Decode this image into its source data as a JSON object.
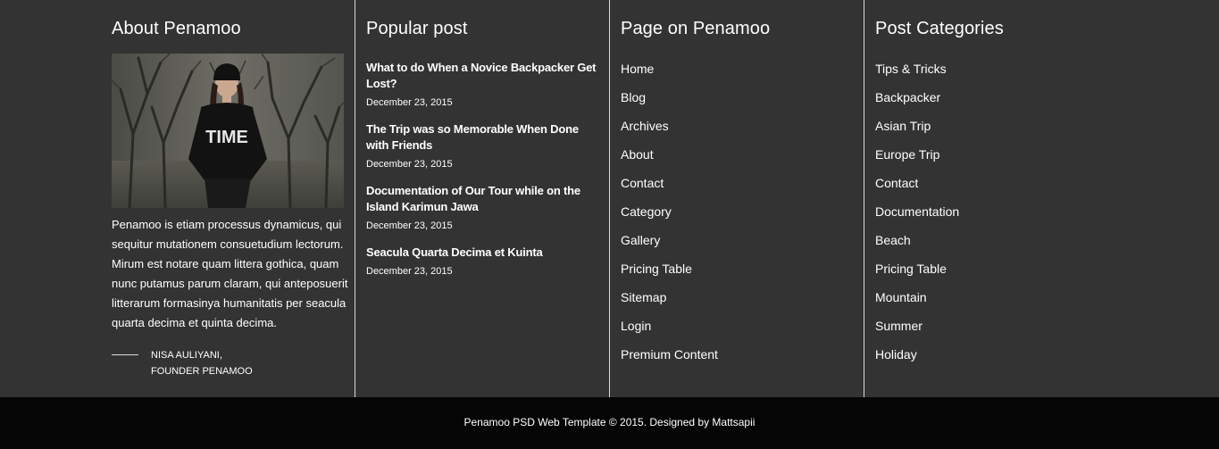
{
  "about": {
    "title": "About Penamoo",
    "text": "Penamoo is etiam processus dynamicus, qui sequitur mutationem consuetudium lectorum. Mirum est notare quam littera gothica, quam nunc putamus parum claram, qui anteposuerit litterarum formasinya humanitatis per seacula quarta decima et quinta decima.",
    "signature_name": "NISA AULIYANI,",
    "signature_role": "FOUNDER PENAMOO",
    "photo_shirt_text": "TIME"
  },
  "popular": {
    "title": "Popular post",
    "posts": [
      {
        "title": "What to do When a Novice Backpacker Get Lost?",
        "date": "December 23, 2015"
      },
      {
        "title": "The Trip was so Memorable When Done with Friends",
        "date": "December 23, 2015"
      },
      {
        "title": "Documentation of Our Tour while on the Island Karimun Jawa",
        "date": "December 23, 2015"
      },
      {
        "title": "Seacula Quarta Decima et Kuinta",
        "date": "December 23, 2015"
      }
    ]
  },
  "pages": {
    "title": "Page on Penamoo",
    "items": [
      "Home",
      "Blog",
      "Archives",
      "About",
      "Contact",
      "Category",
      "Gallery",
      "Pricing Table",
      "Sitemap",
      "Login",
      "Premium Content"
    ]
  },
  "categories": {
    "title": "Post Categories",
    "items": [
      "Tips & Tricks",
      "Backpacker",
      "Asian Trip",
      "Europe Trip",
      "Contact",
      "Documentation",
      "Beach",
      "Pricing Table",
      "Mountain",
      "Summer",
      "Holiday"
    ]
  },
  "footer": {
    "copyright": "Penamoo PSD Web Template © 2015. Designed by Mattsapii"
  },
  "colors": {
    "background": "#333333",
    "bottom_bar": "#050505",
    "divider": "#d9d9d9",
    "text": "#ffffff"
  }
}
